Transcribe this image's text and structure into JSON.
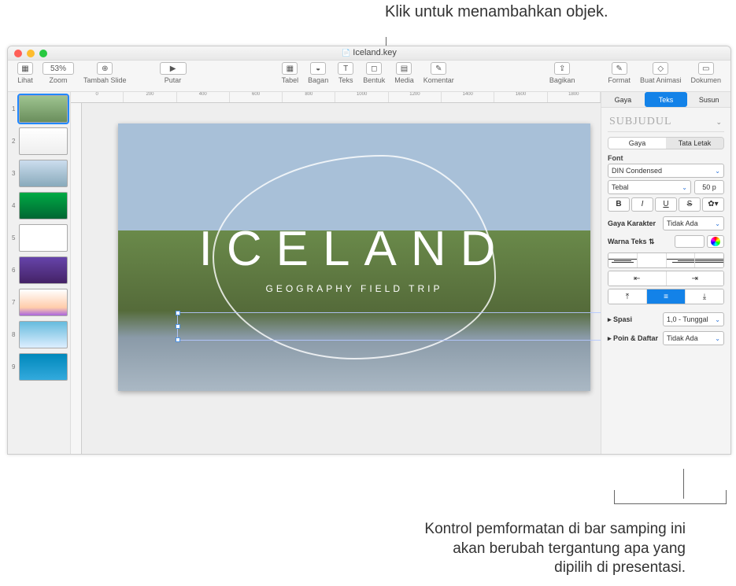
{
  "callouts": {
    "top": "Klik untuk menambahkan objek.",
    "bottom": "Kontrol pemformatan di bar samping ini akan berubah tergantung apa yang dipilih di presentasi."
  },
  "window": {
    "title": "Iceland.key"
  },
  "toolbar": {
    "lihat": "Lihat",
    "zoom": "Zoom",
    "zoom_value": "53%",
    "tambah_slide": "Tambah Slide",
    "putar": "Putar",
    "tabel": "Tabel",
    "bagan": "Bagan",
    "teks": "Teks",
    "bentuk": "Bentuk",
    "media": "Media",
    "komentar": "Komentar",
    "bagikan": "Bagikan",
    "format": "Format",
    "buat_animasi": "Buat Animasi",
    "dokumen": "Dokumen"
  },
  "ruler_marks": [
    "0",
    "200",
    "400",
    "600",
    "800",
    "1000",
    "1200",
    "1400",
    "1600",
    "1800"
  ],
  "slide": {
    "title": "ICELAND",
    "subtitle": "GEOGRAPHY FIELD TRIP"
  },
  "slides": [
    "1",
    "2",
    "3",
    "4",
    "5",
    "6",
    "7",
    "8",
    "9"
  ],
  "sidebar": {
    "tabs": {
      "gaya": "Gaya",
      "teks": "Teks",
      "susun": "Susun"
    },
    "paragraph_style": "SUBJUDUL",
    "subtabs": {
      "gaya": "Gaya",
      "tata_letak": "Tata Letak"
    },
    "font_label": "Font",
    "font_family": "DIN Condensed",
    "font_style": "Tebal",
    "font_size": "50 p",
    "bold": "B",
    "italic": "I",
    "underline": "U",
    "strike": "S",
    "gear": "✿▾",
    "gaya_karakter": "Gaya Karakter",
    "gaya_karakter_val": "Tidak Ada",
    "warna_teks": "Warna Teks",
    "spasi": "Spasi",
    "spasi_val": "1,0 - Tunggal",
    "poin_daftar": "Poin & Daftar",
    "poin_daftar_val": "Tidak Ada"
  }
}
